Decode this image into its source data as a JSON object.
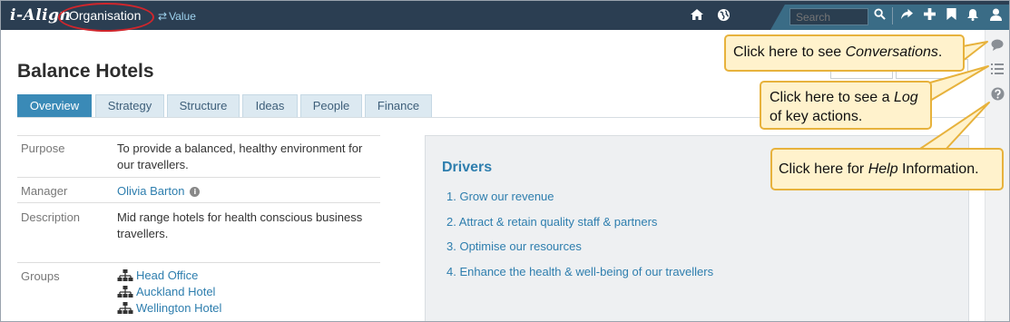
{
  "topbar": {
    "logo": "i-Align",
    "section_label": "Organisation",
    "switch_label": "Value",
    "search_placeholder": "Search"
  },
  "page": {
    "title": "Balance Hotels",
    "tabs": [
      "Overview",
      "Strategy",
      "Structure",
      "Ideas",
      "People",
      "Finance"
    ],
    "active_tab": "Overview"
  },
  "details": {
    "purpose_label": "Purpose",
    "purpose_value": "To provide a balanced, healthy environment for our travellers.",
    "manager_label": "Manager",
    "manager_value": "Olivia Barton",
    "description_label": "Description",
    "description_value": "Mid range hotels for health conscious business travellers.",
    "groups_label": "Groups",
    "groups": [
      "Head Office",
      "Auckland Hotel",
      "Wellington Hotel"
    ]
  },
  "drivers": {
    "heading": "Drivers",
    "items": [
      "1. Grow our revenue",
      "2. Attract & retain quality staff & partners",
      "3. Optimise our resources",
      "4. Enhance the health & well-being of our travellers"
    ]
  },
  "callouts": {
    "conversations": {
      "prefix": "Click here to see ",
      "emph": "Conversations",
      "suffix": "."
    },
    "log": {
      "prefix": "Click here to see a ",
      "emph": "Log",
      "suffix": "of key actions."
    },
    "help": {
      "prefix": "Click here for ",
      "emph": "Help",
      "suffix": " Information."
    }
  },
  "colors": {
    "topbar": "#2b3e52",
    "accent": "#3a8ab7",
    "link": "#2e7eae",
    "callout_bg": "#fff2cc",
    "callout_border": "#e7b23c",
    "highlight_ring": "#d0262c"
  },
  "icons": {
    "topbar": [
      "home-icon",
      "globe-icon",
      "search-icon",
      "share-icon",
      "plus-icon",
      "bookmark-icon",
      "bell-icon",
      "user-icon"
    ],
    "sidebar": [
      "conversations-icon",
      "log-icon",
      "help-icon"
    ]
  }
}
